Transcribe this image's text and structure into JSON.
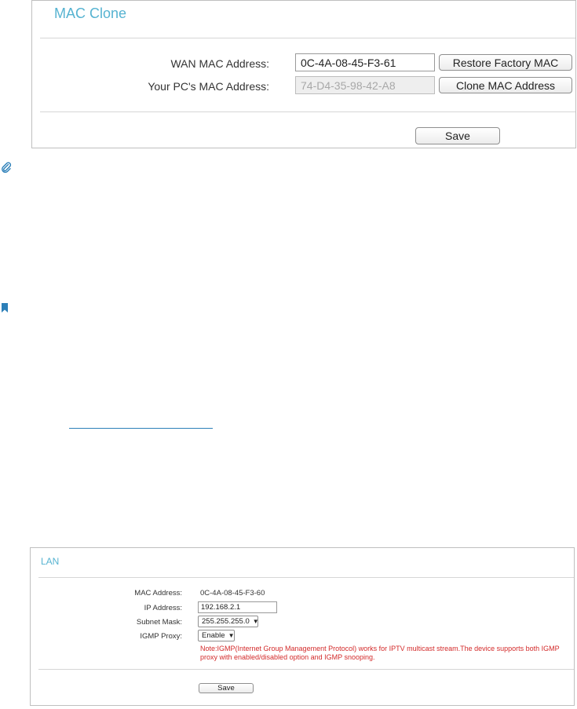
{
  "mac_clone": {
    "title": "MAC Clone",
    "wan_label": "WAN MAC Address:",
    "wan_value": "0C-4A-08-45-F3-61",
    "restore_button": "Restore Factory MAC",
    "pc_label": "Your PC's MAC Address:",
    "pc_value": "74-D4-35-98-42-A8",
    "clone_button": "Clone MAC Address",
    "save_button": "Save"
  },
  "lan": {
    "title": "LAN",
    "mac_label": "MAC Address:",
    "mac_value": "0C-4A-08-45-F3-60",
    "ip_label": "IP Address:",
    "ip_value": "192.168.2.1",
    "subnet_label": "Subnet Mask:",
    "subnet_value": "255.255.255.0",
    "igmp_label": "IGMP Proxy:",
    "igmp_value": "Enable",
    "note": "Note:IGMP(Internet Group Management Protocol) works for IPTV multicast stream.The device supports both IGMP proxy with enabled/disabled option and IGMP snooping.",
    "save_button": "Save"
  },
  "icons": {
    "note_icon": "paperclip-icon",
    "tips_icon": "bookmark-icon",
    "accent_color": "#2c7fb8",
    "title_color": "#56b3d1",
    "note_color": "#d32a2a"
  }
}
